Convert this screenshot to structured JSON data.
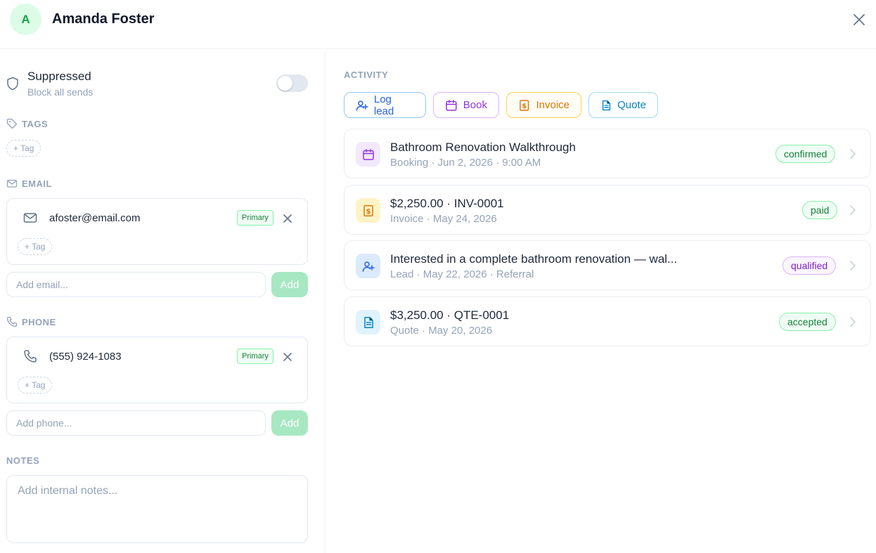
{
  "header": {
    "avatar_initial": "A",
    "contact_name": "Amanda Foster"
  },
  "suppressed": {
    "title": "Suppressed",
    "subtitle": "Block all sends",
    "enabled": false
  },
  "tags": {
    "label": "TAGS",
    "add_tag": "+ Tag"
  },
  "email": {
    "label": "EMAIL",
    "value": "afoster@email.com",
    "primary_badge": "Primary",
    "add_tag": "+ Tag",
    "input_placeholder": "Add email...",
    "add_button": "Add"
  },
  "phone": {
    "label": "PHONE",
    "value": "(555) 924-1083",
    "primary_badge": "Primary",
    "add_tag": "+ Tag",
    "input_placeholder": "Add phone...",
    "add_button": "Add"
  },
  "notes": {
    "label": "NOTES",
    "placeholder": "Add internal notes..."
  },
  "activity": {
    "label": "ACTIVITY",
    "actions": [
      {
        "label": "Log lead",
        "icon": "user-plus-icon"
      },
      {
        "label": "Book",
        "icon": "calendar-icon"
      },
      {
        "label": "Invoice",
        "icon": "invoice-icon"
      },
      {
        "label": "Quote",
        "icon": "document-icon"
      }
    ],
    "items": [
      {
        "title": "Bathroom Renovation Walkthrough",
        "subtitle": "Booking · Jun 2, 2026 · 9:00 AM",
        "status": "confirmed",
        "icon": "calendar-icon"
      },
      {
        "title": "$2,250.00 · INV-0001",
        "subtitle": "Invoice · May 24, 2026",
        "status": "paid",
        "icon": "invoice-icon"
      },
      {
        "title": "Interested in a complete bathroom renovation — wal...",
        "subtitle": "Lead · May 22, 2026 · Referral",
        "status": "qualified",
        "icon": "user-plus-icon"
      },
      {
        "title": "$3,250.00 · QTE-0001",
        "subtitle": "Quote · May 20, 2026",
        "status": "accepted",
        "icon": "document-icon"
      }
    ]
  },
  "colors": {
    "avatar_bg": "#dcfce7",
    "avatar_text": "#16a34a",
    "lead": "#2563eb",
    "book": "#9333ea",
    "invoice": "#d97706",
    "quote": "#0284c7",
    "status_green": "#15803d",
    "status_purple": "#7e22ce",
    "add_button_disabled": "#a7e8c3"
  }
}
